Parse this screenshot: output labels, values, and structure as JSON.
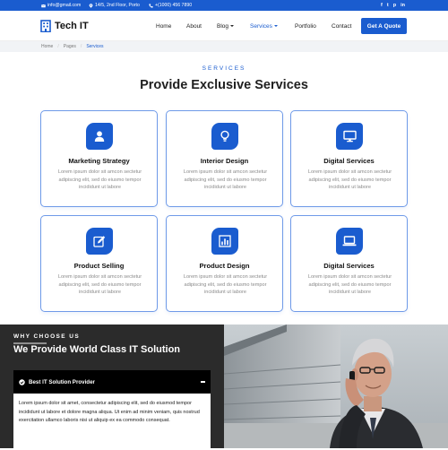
{
  "topbar": {
    "email": "info@gmail.com",
    "address": "14/5, 2nd Floor, Porto",
    "phone": "+(1000) 456 7890",
    "social": [
      "f",
      "t",
      "p",
      "in"
    ]
  },
  "brand": {
    "name": "Tech IT"
  },
  "nav": {
    "home": "Home",
    "about": "About",
    "blog": "Blog",
    "services": "Services",
    "portfolio": "Portfolio",
    "contact": "Contact",
    "cta": "Get A Quote"
  },
  "breadcrumb": {
    "home": "Home",
    "pages": "Pages",
    "current": "Services"
  },
  "services": {
    "eyebrow": "SERVICES",
    "title": "Provide Exclusive Services",
    "cards": [
      {
        "title": "Marketing Strategy",
        "text": "Lorem ipsum dolor sit amcon sectetur adipiscing elit, sed do eiusmo tempor incididunt ut labore",
        "icon": "user-icon"
      },
      {
        "title": "Interior Design",
        "text": "Lorem ipsum dolor sit amcon sectetur adipiscing elit, sed do eiusmo tempor incididunt ut labore",
        "icon": "lightbulb-icon"
      },
      {
        "title": "Digital Services",
        "text": "Lorem ipsum dolor sit amcon sectetur adipiscing elit, sed do eiusmo tempor incididunt ut labore",
        "icon": "monitor-icon"
      },
      {
        "title": "Product Selling",
        "text": "Lorem ipsum dolor sit amcon sectetur adipiscing elit, sed do eiusmo tempor incididunt ut labore",
        "icon": "edit-icon"
      },
      {
        "title": "Product Design",
        "text": "Lorem ipsum dolor sit amcon sectetur adipiscing elit, sed do eiusmo tempor incididunt ut labore",
        "icon": "bar-chart-icon"
      },
      {
        "title": "Digital Services",
        "text": "Lorem ipsum dolor sit amcon sectetur adipiscing elit, sed do eiusmo tempor incididunt ut labore",
        "icon": "laptop-icon"
      }
    ]
  },
  "why": {
    "eyebrow": "WHY CHOOSE US",
    "title": "We Provide World Class IT Solution",
    "accordion": {
      "label": "Best IT Solution Provider",
      "body": "Lorem ipsum dolor sit amet, consectetur adipiscing elit, sed do eiusmod tempor incididunt ut labore et dolore magna aliqua. Ut enim ad minim veniam, quis nostrud exercitation ullamco laboris nisi ut aliquip ex ea commodo consequat."
    }
  },
  "colors": {
    "brand": "#1a5ccf",
    "dark": "#2b2b2b",
    "muted": "#8a8a8a"
  }
}
